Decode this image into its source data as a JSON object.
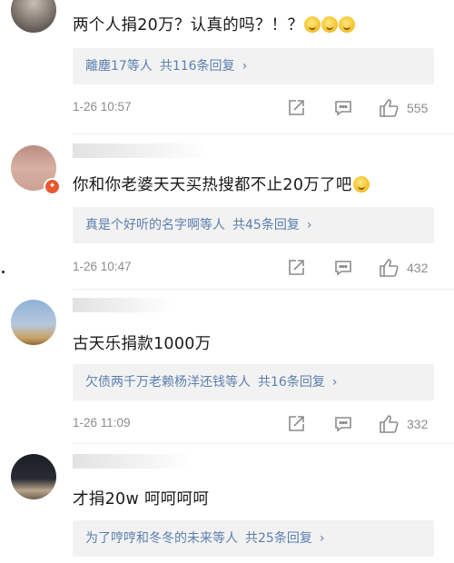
{
  "comments": [
    {
      "text": "两个人捐20万？认真的吗？！？",
      "emoji_count": 3,
      "reply_users": "離塵17等人",
      "reply_count": "共116条回复",
      "time": "1-26 10:57",
      "likes": "555"
    },
    {
      "text": "你和你老婆天天买热搜都不止20万了吧",
      "emoji_count": 1,
      "reply_users": "真是个好听的名字啊等人",
      "reply_count": "共45条回复",
      "time": "1-26 10:47",
      "likes": "432"
    },
    {
      "text": "古天乐捐款1000万",
      "emoji_count": 0,
      "reply_users": "欠债两千万老赖杨洋还钱等人",
      "reply_count": "共16条回复",
      "time": "1-26 11:09",
      "likes": "332"
    },
    {
      "text": "才捐20w 呵呵呵呵",
      "emoji_count": 0,
      "reply_users": "为了哼哼和冬冬的未来等人",
      "reply_count": "共25条回复",
      "time": "",
      "likes": ""
    }
  ],
  "icons": {
    "share": "share-icon",
    "comment": "comment-icon",
    "like": "thumbs-up-icon",
    "chevron": "chevron-right-icon",
    "verified": "verified-badge-icon"
  },
  "colors": {
    "link": "#5b7fae",
    "meta": "#8c8c8c",
    "reply_bg": "#f2f2f2",
    "badge": "#e8582f"
  }
}
